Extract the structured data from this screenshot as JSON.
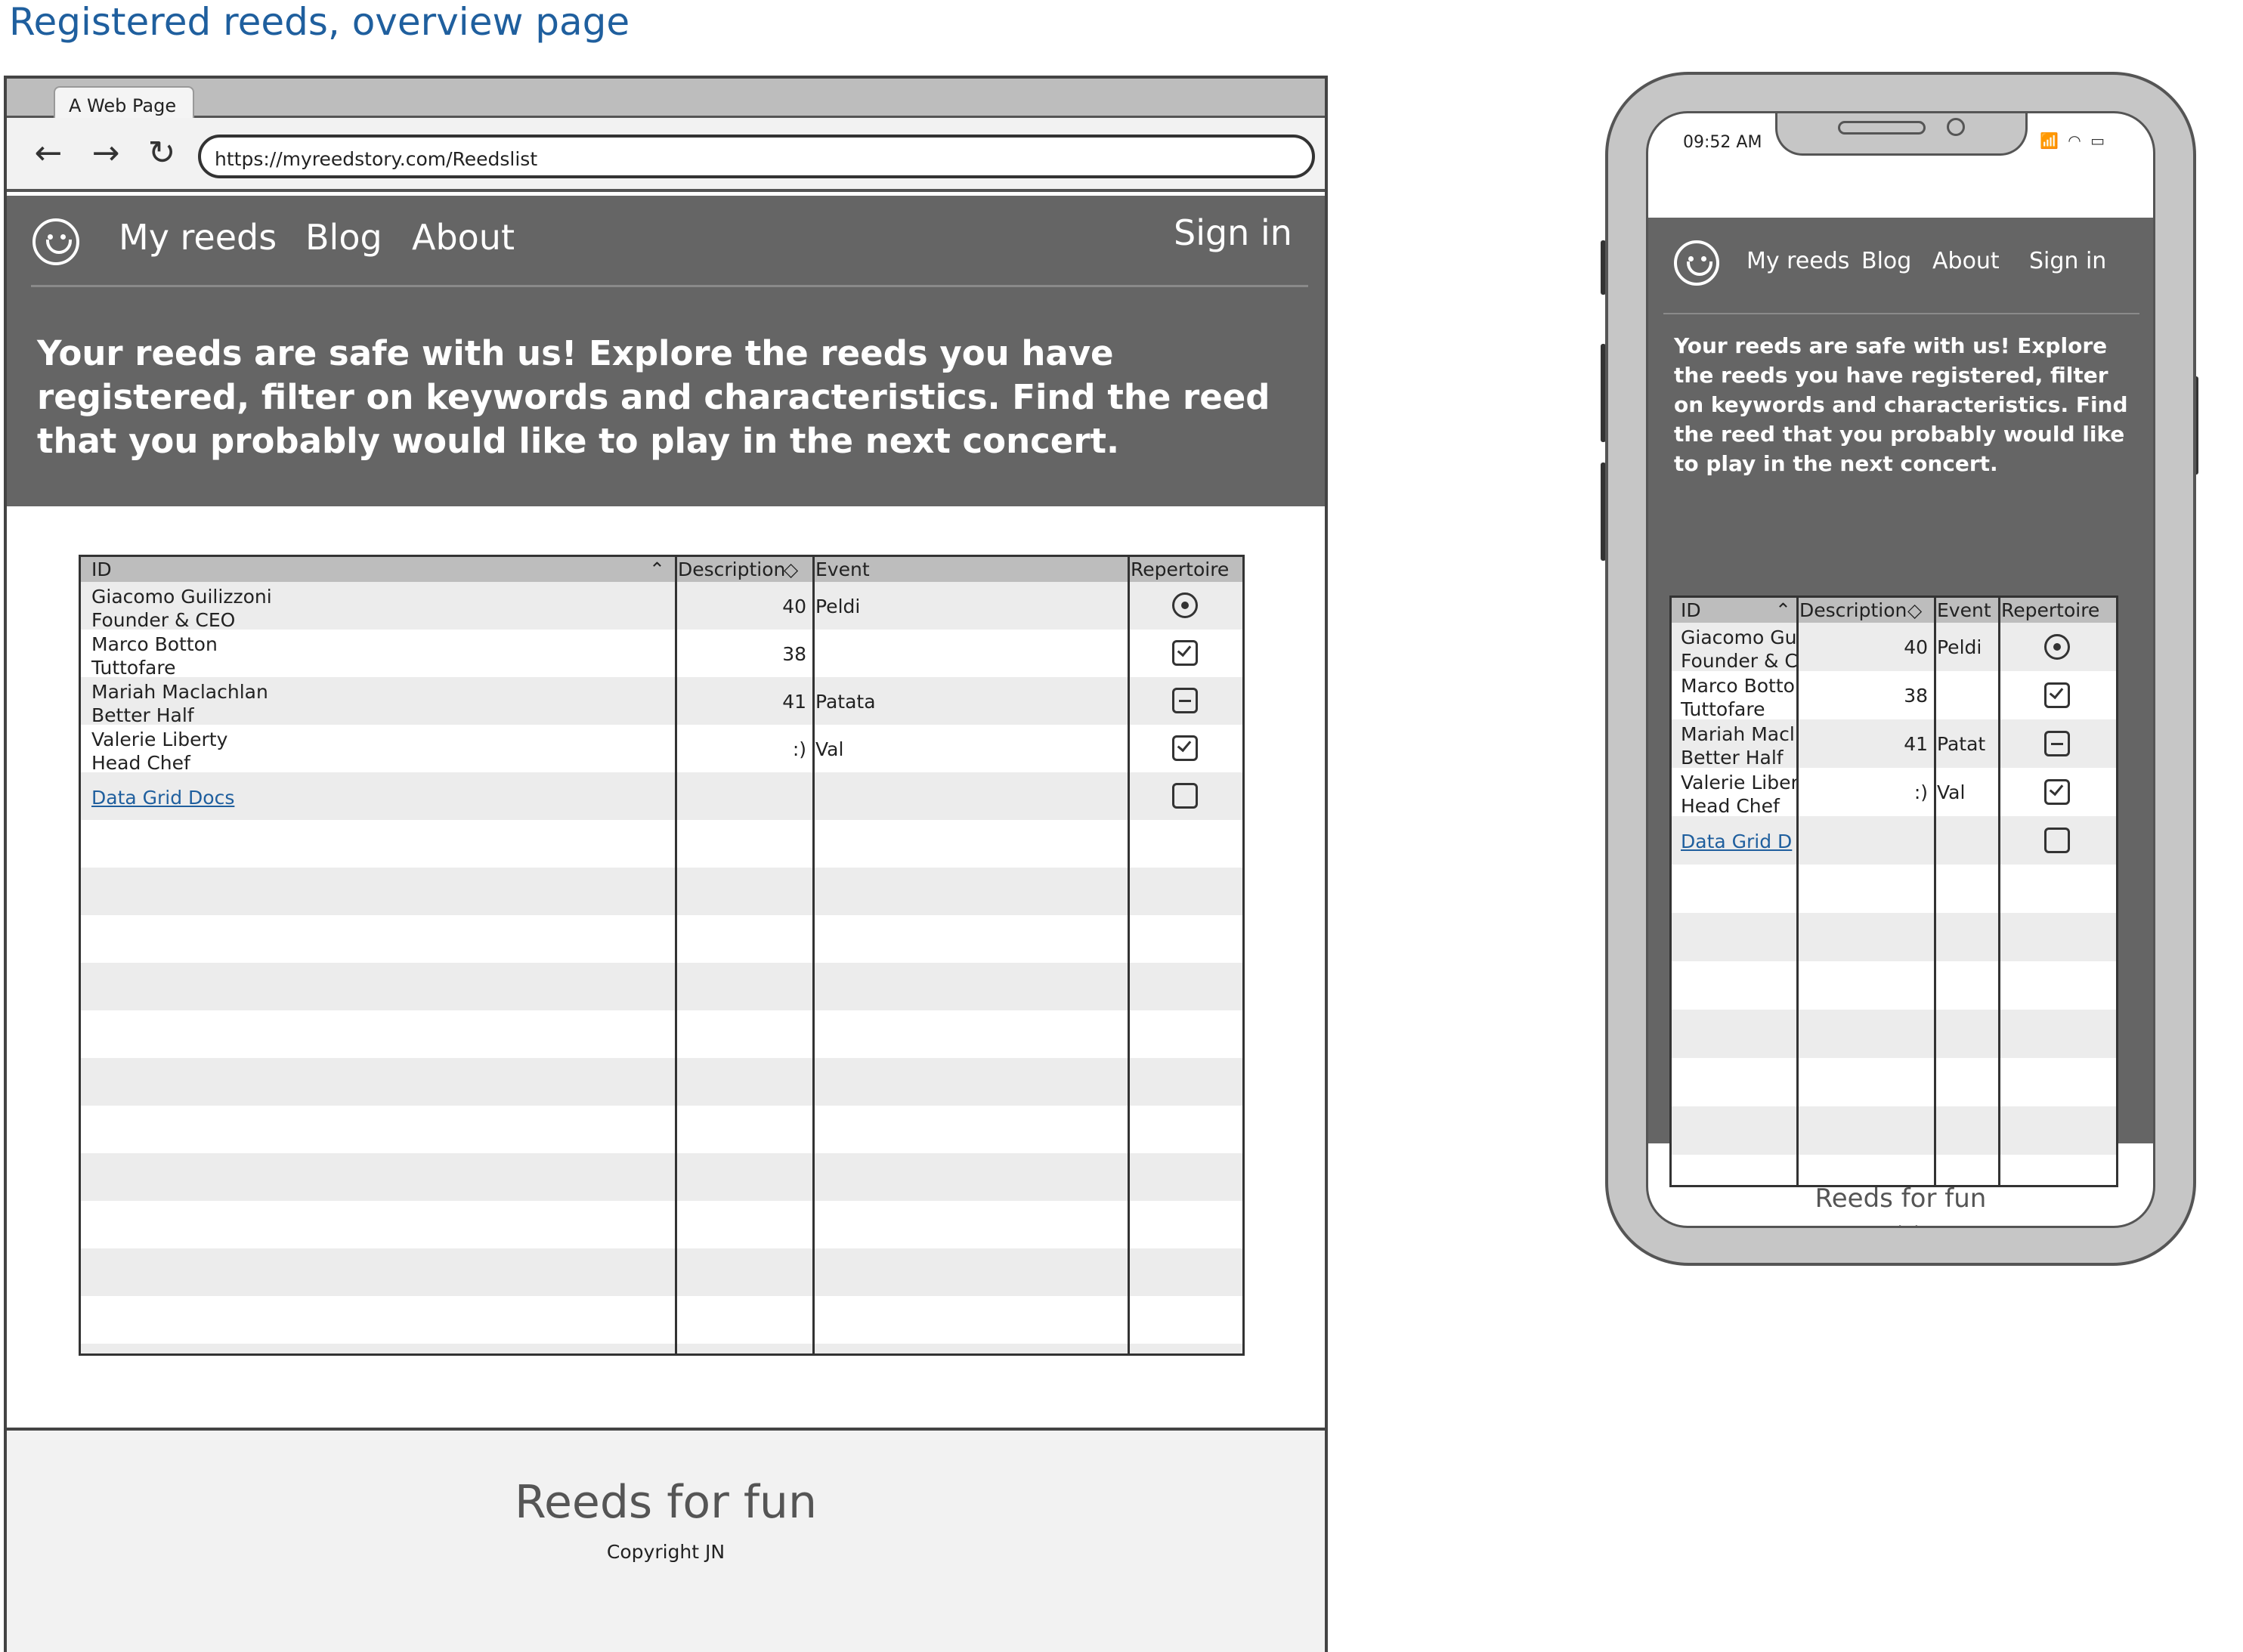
{
  "page": {
    "title": "Registered reeds, overview page"
  },
  "browser": {
    "tab_label": "A Web Page",
    "url": "https://myreedstory.com/Reedslist",
    "back_glyph": "←",
    "forward_glyph": "→",
    "reload_glyph": "↻"
  },
  "nav": {
    "my_reeds": "My reeds",
    "blog": "Blog",
    "about": "About",
    "sign_in": "Sign in"
  },
  "hero": {
    "text": "Your reeds are safe with us! Explore the reeds you have registered, filter on keywords and characteristics. Find the reed that you probably would like to play in the next concert."
  },
  "grid": {
    "columns": {
      "id": "ID",
      "description": "Description",
      "event": "Event",
      "repertoire": "Repertoire"
    },
    "rows": [
      {
        "name": "Giacomo Guilizzoni",
        "role": "Founder & CEO",
        "description": "40",
        "event": "Peldi",
        "repertoire": "radio"
      },
      {
        "name": "Marco Botton",
        "role": "Tuttofare",
        "description": "38",
        "event": "",
        "repertoire": "checked"
      },
      {
        "name": "Mariah Maclachlan",
        "role": "Better Half",
        "description": "41",
        "event": "Patata",
        "repertoire": "indeterminate"
      },
      {
        "name": "Valerie Liberty",
        "role": "Head Chef",
        "description": ":)",
        "event": "Val",
        "repertoire": "checked"
      },
      {
        "name": "Data Grid Docs",
        "role": "",
        "description": "",
        "event": "",
        "repertoire": "unchecked",
        "is_link": true
      }
    ]
  },
  "mobile_grid": {
    "rows": [
      {
        "name": "Giacomo Gu",
        "role": "Founder & C",
        "event": "Peldi"
      },
      {
        "name": "Marco Botto",
        "role": "Tuttofare",
        "event": ""
      },
      {
        "name": "Mariah Macl",
        "role": "Better Half",
        "event": "Patat"
      },
      {
        "name": "Valerie Liber",
        "role": "Head Chef",
        "event": "Val"
      },
      {
        "name": "Data Grid D",
        "role": "",
        "event": ""
      }
    ]
  },
  "footer": {
    "title": "Reeds for fun",
    "copyright": "Copyright JN"
  },
  "phone": {
    "time": "09:52 AM",
    "status_icons": "📶 ◠ ▭"
  },
  "colors": {
    "header_bg": "#656565",
    "title_blue": "#1f5f9e",
    "grid_header": "#bdbdbd",
    "stripe": "#ececec"
  }
}
